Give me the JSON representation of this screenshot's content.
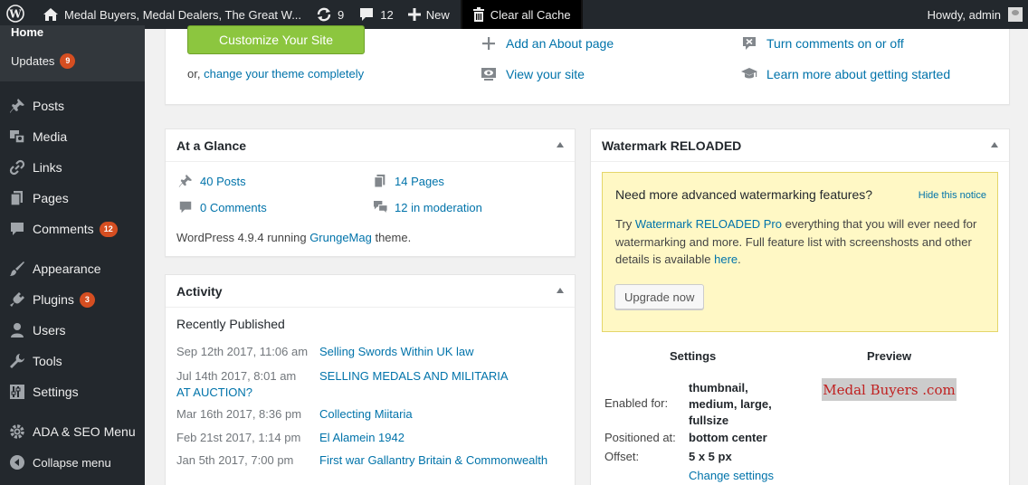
{
  "adminbar": {
    "site_title": "Medal Buyers, Medal Dealers, The Great W...",
    "updates_count": "9",
    "comments_count": "12",
    "new_label": "New",
    "clear_cache_label": "Clear all Cache",
    "howdy": "Howdy, admin"
  },
  "sidebar": {
    "home_label": "Home",
    "updates_label": "Updates",
    "updates_badge": "9",
    "items": [
      {
        "label": "Posts",
        "icon": "pin-icon"
      },
      {
        "label": "Media",
        "icon": "media-icon"
      },
      {
        "label": "Links",
        "icon": "link-icon"
      },
      {
        "label": "Pages",
        "icon": "pages-icon"
      },
      {
        "label": "Comments",
        "icon": "comment-icon",
        "badge": "12"
      },
      {
        "label": "Appearance",
        "icon": "brush-icon"
      },
      {
        "label": "Plugins",
        "icon": "plugin-icon",
        "badge": "3"
      },
      {
        "label": "Users",
        "icon": "user-icon"
      },
      {
        "label": "Tools",
        "icon": "wrench-icon"
      },
      {
        "label": "Settings",
        "icon": "settings-icon"
      },
      {
        "label": "ADA & SEO Menu",
        "icon": "gear-icon"
      },
      {
        "label": "Collapse menu",
        "icon": "collapse-icon"
      }
    ]
  },
  "welcome": {
    "customize_label": "Customize Your Site",
    "or_text": "or,",
    "change_theme_link": "change your theme completely",
    "add_about_link": "Add an About page",
    "view_site_link": "View your site",
    "turn_comments_link": "Turn comments on or off",
    "learn_more_link": "Learn more about getting started"
  },
  "glance": {
    "title": "At a Glance",
    "posts": "40 Posts",
    "pages": "14 Pages",
    "comments": "0 Comments",
    "moderation": "12 in moderation",
    "version_prefix": "WordPress 4.9.4 running",
    "theme_name": "GrungeMag",
    "version_suffix": "theme."
  },
  "activity": {
    "title": "Activity",
    "recently_published": "Recently Published",
    "rows": [
      {
        "date": "Sep 12th 2017, 11:06 am",
        "title": "Selling Swords Within UK law"
      },
      {
        "date": "Jul 14th 2017, 8:01 am",
        "title": "SELLING MEDALS AND MILITARIA AT AUCTION?"
      },
      {
        "date": "Mar 16th 2017, 8:36 pm",
        "title": "Collecting Miitaria"
      },
      {
        "date": "Feb 21st 2017, 1:14 pm",
        "title": "El Alamein 1942"
      },
      {
        "date": "Jan 5th 2017, 7:00 pm",
        "title": "First war Gallantry Britain & Commonwealth"
      }
    ]
  },
  "watermark": {
    "title": "Watermark RELOADED",
    "notice_title": "Need more advanced watermarking features?",
    "hide_notice": "Hide this notice",
    "body_prefix": "Try",
    "pro_link": "Watermark RELOADED Pro",
    "body_middle": "everything that you will ever need for watermarking and more. Full feature list with screenshosts and other details is available",
    "here_link": "here",
    "body_end": ".",
    "upgrade_label": "Upgrade now",
    "settings_head": "Settings",
    "preview_head": "Preview",
    "enabled_label": "Enabled for:",
    "enabled_value": "thumbnail, medium, large, fullsize",
    "positioned_label": "Positioned at:",
    "positioned_value": "bottom center",
    "offset_label": "Offset:",
    "offset_value": "5 x 5 px",
    "change_settings": "Change settings",
    "preview_text": "Medal Buyers .com"
  },
  "colors": {
    "adminbar_bg": "#23282d",
    "link": "#0073aa",
    "badge": "#d54e21",
    "customize_button": "#8cc63f",
    "notice_bg": "#fff8c5"
  }
}
